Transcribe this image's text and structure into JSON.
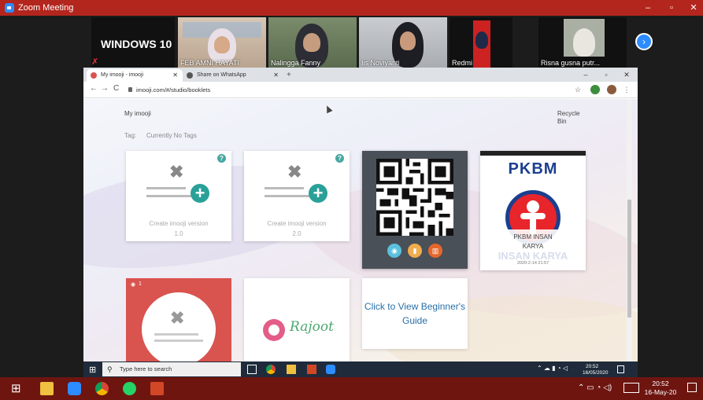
{
  "zoom": {
    "title": "Zoom Meeting",
    "controls": {
      "minimize": "–",
      "maximize": "▫",
      "close": "✕"
    },
    "speaker_label": "WINDOWS 10",
    "participants": [
      {
        "name": "FEB AMNI HAYATI"
      },
      {
        "name": "Nalingga Fanny"
      },
      {
        "name": "Iis Noviyanti"
      },
      {
        "name": "Redmi"
      },
      {
        "name": "Risna gusna putr..."
      }
    ],
    "next_icon": "chevron-right-icon"
  },
  "chrome": {
    "tabs": [
      {
        "label": "My imooji - imooji",
        "close": "✕"
      },
      {
        "label": "Share on WhatsApp",
        "close": "✕"
      }
    ],
    "new_tab": "+",
    "controls": {
      "minimize": "–",
      "maximize": "▫",
      "close": "✕"
    },
    "nav": {
      "back": "←",
      "forward": "→",
      "reload": "C"
    },
    "url": "imooji.com/#/studio/booklets",
    "star": "☆"
  },
  "page": {
    "heading": "My imooji",
    "recycle_bin": "Recycle Bin",
    "tag_label": "Tag:",
    "tag_value": "Currently No Tags",
    "cards": [
      {
        "help": "?",
        "label": "Create imooji version",
        "version": "1.0"
      },
      {
        "help": "?",
        "label": "Create imooji version",
        "version": "2.0"
      }
    ],
    "pkbm": {
      "logo_text": "PKBM",
      "name_line1": "PKBM INSAN",
      "name_line2": "KARYA",
      "watermark": "INSAN KARYA",
      "date": "2020-2-14 21:57"
    },
    "red_card_count": "1",
    "rajoot_text": "Rajoot",
    "guide_text": "Click to View Beginner's Guide"
  },
  "inner_taskbar": {
    "search_placeholder": "Type here to search",
    "time": "20:52",
    "date": "16/05/2020"
  },
  "taskbar": {
    "time": "20:52",
    "date": "16-May-20"
  },
  "colors": {
    "zoom_bar": "#b3261e",
    "taskbar": "#6e1510",
    "help_badge": "#49a8a0",
    "plus": "#2aa198",
    "pkbm_blue": "#1b3f8f",
    "pkbm_red": "#e8252a",
    "guide_link": "#2a6fa8"
  }
}
